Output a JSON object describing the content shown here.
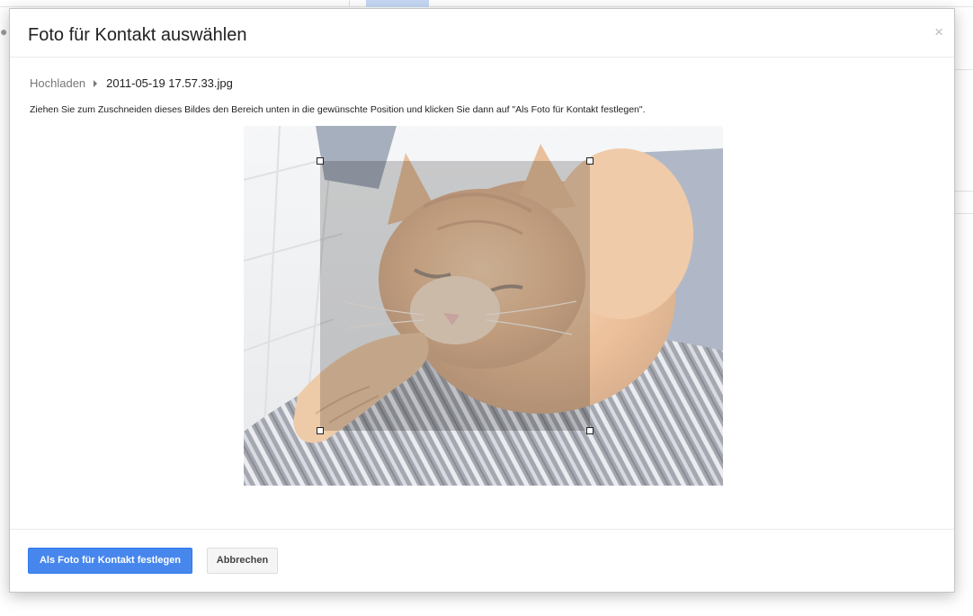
{
  "dialog": {
    "title": "Foto für Kontakt auswählen",
    "close_glyph": "×",
    "close_icon": "close-icon"
  },
  "breadcrumb": {
    "upload_label": "Hochladen",
    "separator_icon": "triangle-right-icon",
    "file_name": "2011-05-19 17.57.33.jpg"
  },
  "instruction": "Ziehen Sie zum Zuschneiden dieses Bildes den Bereich unten in die gewünschte Position und klicken Sie dann auf \"Als Foto für Kontakt festlegen\".",
  "photo": {
    "subject": "orange cat sleeping on striped fabric"
  },
  "footer": {
    "primary_button": "Als Foto für Kontakt festlegen",
    "cancel_button": "Abbrechen"
  },
  "colors": {
    "primary_button_bg": "#4787ed",
    "title_text": "#222222",
    "muted_text": "#777777"
  }
}
